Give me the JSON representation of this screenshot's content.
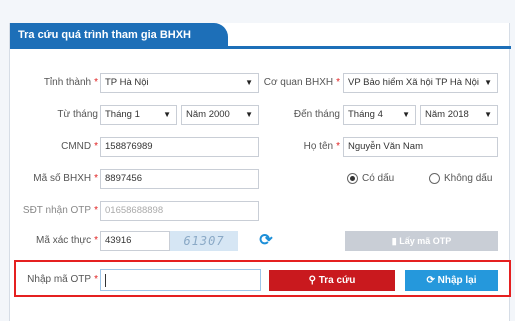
{
  "header": {
    "title": "Tra cứu quá trình tham gia BHXH"
  },
  "form": {
    "province": {
      "label": "Tỉnh thành",
      "required": "*",
      "value": "TP Hà Nội"
    },
    "agency": {
      "label": "Cơ quan BHXH",
      "required": "*",
      "value": "VP Bảo hiểm Xã hội TP Hà Nội"
    },
    "from": {
      "label": "Từ tháng",
      "month": "Tháng 1",
      "year": "Năm 2000"
    },
    "to": {
      "label": "Đến tháng",
      "month": "Tháng 4",
      "year": "Năm 2018"
    },
    "cmnd": {
      "label": "CMND",
      "required": "*",
      "value": "158876989"
    },
    "name": {
      "label": "Họ tên",
      "required": "*",
      "value": "Nguyễn Văn Nam"
    },
    "bhxh": {
      "label": "Mã số BHXH",
      "required": "*",
      "value": "8897456"
    },
    "diacritics": {
      "with_label": "Có dấu",
      "without_label": "Không dấu",
      "selected": "with"
    },
    "phone": {
      "label": "SĐT nhận OTP",
      "required": "*",
      "value": "01658688898"
    },
    "captcha": {
      "label": "Mã xác thực",
      "required": "*",
      "value": "43916",
      "image_text": "61307"
    },
    "get_otp": {
      "label": "Lấy mã OTP"
    },
    "otp": {
      "label": "Nhập mã OTP",
      "required": "*",
      "value": ""
    },
    "search_button": {
      "label": "Tra cứu"
    },
    "reset_button": {
      "label": "Nhập lại"
    }
  },
  "colors": {
    "brand": "#1d6fb8",
    "search": "#c9191e",
    "reset": "#2598dc",
    "highlight": "#e52020"
  }
}
